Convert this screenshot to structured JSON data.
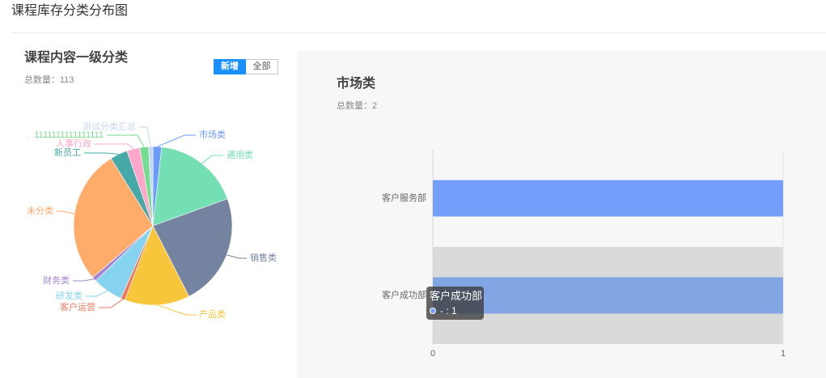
{
  "page": {
    "title": "课程库存分类分布图"
  },
  "theme": {
    "accent": "#1890ff",
    "panel_bg": "#f7f7f7"
  },
  "left": {
    "toggle": {
      "options": [
        "新增",
        "全部"
      ],
      "active": 0
    }
  },
  "chart_data": [
    {
      "type": "pie",
      "title": "课程内容一级分类",
      "total_label": "总数量：113",
      "categories": [
        "市场类",
        "通用类",
        "销售类",
        "产品类",
        "客户运营",
        "研发类",
        "财务类",
        "未分类",
        "新员工",
        "人事行政",
        "1111111111111111",
        "测试分类汇总"
      ],
      "values": [
        2,
        20,
        26,
        15,
        1,
        7,
        1,
        31,
        4,
        3,
        2,
        1
      ],
      "colors": [
        "#6c9bf9",
        "#74dfb3",
        "#74839f",
        "#f8c63b",
        "#ec7a60",
        "#86d3f0",
        "#a384d4",
        "#ffab6a",
        "#46a8a7",
        "#ffa6cb",
        "#74dd8f",
        "#c5d6f3"
      ]
    },
    {
      "type": "bar",
      "title": "市场类",
      "total_label": "总数量：2",
      "categories": [
        "客户服务部",
        "客户成功部"
      ],
      "series": [
        {
          "values": [
            1,
            1
          ],
          "color": "#739ffa",
          "hover_color": "#82a5e4"
        }
      ],
      "xlim": [
        0,
        1
      ],
      "xticks": [
        "0",
        "1"
      ],
      "grid": true,
      "hover_index": 1,
      "tooltip": {
        "title": "客户成功部",
        "text": "- : 1"
      }
    }
  ]
}
